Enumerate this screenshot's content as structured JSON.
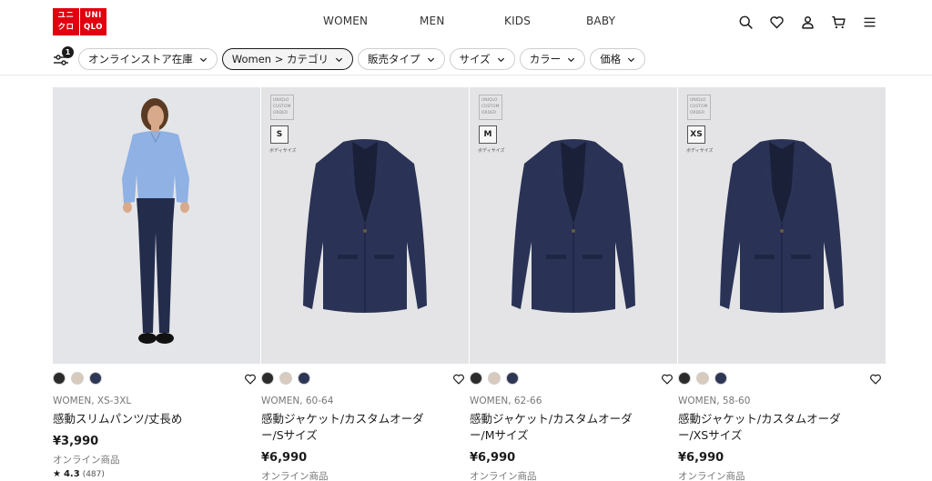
{
  "logo": {
    "line1": "ユニ",
    "line2": "クロ",
    "line3": "UNI",
    "line4": "QLO"
  },
  "nav": [
    "WOMEN",
    "MEN",
    "KIDS",
    "BABY"
  ],
  "header_icons": [
    "search-icon",
    "heart-icon",
    "user-icon",
    "cart-icon",
    "menu-icon"
  ],
  "filters": {
    "badge_count": "1",
    "pills": [
      {
        "label": "オンラインストア在庫",
        "active": false
      },
      {
        "label": "Women > カテゴリ",
        "active": true
      },
      {
        "label": "販売タイプ",
        "active": false
      },
      {
        "label": "サイズ",
        "active": false
      },
      {
        "label": "カラー",
        "active": false
      },
      {
        "label": "価格",
        "active": false
      }
    ]
  },
  "colors": {
    "brand": "#e0000f",
    "swatch_black": "#2b2b2b",
    "swatch_beige": "#d8cbbd",
    "swatch_navy": "#2e3656"
  },
  "badge_text": {
    "line1": "UNIQLO",
    "line2": "CUSTOM",
    "line3": "ORDER",
    "size_note": "ボディサイズ"
  },
  "products": [
    {
      "meta": "WOMEN, XS-3XL",
      "name": "感動スリムパンツ/丈長め",
      "price": "¥3,990",
      "online": "オンライン商品",
      "rating": "4.3",
      "reviews": "(487)",
      "size": ""
    },
    {
      "meta": "WOMEN, 60-64",
      "name": "感動ジャケット/カスタムオーダー/Sサイズ",
      "price": "¥6,990",
      "online": "オンライン商品",
      "size": "S"
    },
    {
      "meta": "WOMEN, 62-66",
      "name": "感動ジャケット/カスタムオーダー/Mサイズ",
      "price": "¥6,990",
      "online": "オンライン商品",
      "size": "M"
    },
    {
      "meta": "WOMEN, 58-60",
      "name": "感動ジャケット/カスタムオーダー/XSサイズ",
      "price": "¥6,990",
      "online": "オンライン商品",
      "size": "XS"
    }
  ]
}
